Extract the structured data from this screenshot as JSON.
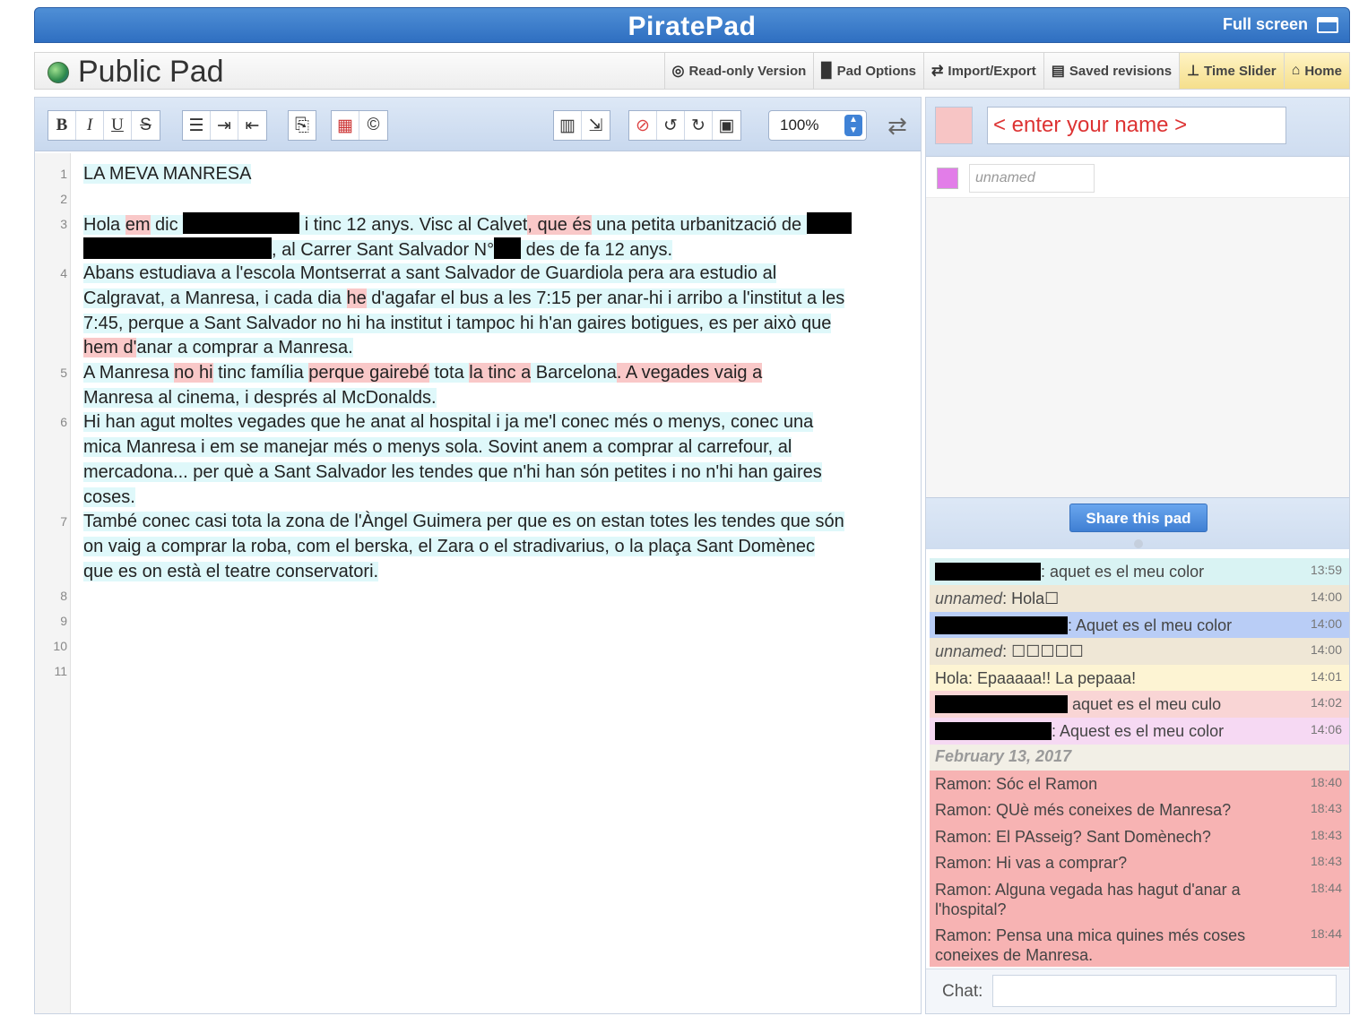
{
  "app": {
    "brand": "PiratePad",
    "fullscreen_label": "Full screen"
  },
  "pad": {
    "title": "Public Pad"
  },
  "nav": [
    {
      "label": "Read-only Version",
      "icon": "eye-icon"
    },
    {
      "label": "Pad Options",
      "icon": "document-icon"
    },
    {
      "label": "Import/Export",
      "icon": "arrows-icon"
    },
    {
      "label": "Saved revisions",
      "icon": "save-icon"
    },
    {
      "label": "Time Slider",
      "icon": "slider-icon"
    },
    {
      "label": "Home",
      "icon": "home-icon"
    }
  ],
  "toolbar": {
    "format": [
      "B",
      "I",
      "U",
      "S"
    ],
    "lists": [
      "☰",
      "⇥",
      "⇤"
    ],
    "zoom": "100%"
  },
  "editor": {
    "line_numbers": [
      "1",
      "2",
      "3",
      "4",
      "5",
      "6",
      "7",
      "8",
      "9",
      "10",
      "11"
    ],
    "line1": "LA MEVA MANRESA",
    "l3a": "Hola ",
    "l3b": "em",
    "l3c": " dic ",
    "l3d": " i tinc 12 anys. Visc al Calvet",
    "l3e": ", que és",
    "l3f": " una petita urbanització de ",
    "l3g": ", al Carrer Sant Salvador N°",
    "l3h": " des de fa 12 anys.",
    "l4a": "Abans estudiava a l'escola Montserrat a sant Salvador de Guardiola pera ara estudio al",
    "l4b": "Calgravat, a Manresa, i cada dia ",
    "l4c": "he",
    "l4d": " d'agafar el bus a les 7:15 per anar-hi i arribo a l'institut a les",
    "l4e": "7:45, perque a Sant Salvador no hi ha institut i tampoc hi h'an gaires botigues, es per això que",
    "l4f": "hem d'",
    "l4g": "anar a comprar a Manresa.",
    "l5a": "A Manresa ",
    "l5b": "no hi",
    "l5c": "  tinc família ",
    "l5d": "perque  gairebé",
    "l5e": " tota ",
    "l5f": "la tinc a",
    "l5g": " Barcelona",
    "l5h": ". A vegades vaig a",
    "l5i": "Manresa al cinema, i després al McDonalds.",
    "l6a": "Hi han agut moltes vegades que he anat al hospital i ja me'l conec més o menys, conec una",
    "l6b": "mica Manresa i em se manejar més o menys sola. Sovint anem a comprar al carrefour,  al",
    "l6c": "mercadona... per què a Sant Salvador les tendes que n'hi han són petites i no n'hi han gaires",
    "l6d": "coses.",
    "l7a": "També conec casi tota la zona de l'Àngel Guimera per que es on estan totes les tendes que són",
    "l7b": "on vaig a comprar la roba, com el berska, el Zara o el stradivarius, o la plaça Sant Domènec",
    "l7c": "que es on està el teatre conservatori."
  },
  "users": {
    "name_placeholder": "< enter your name >",
    "other_user": "unnamed",
    "my_color": "#f7c5c5",
    "other_color": "#e27de8"
  },
  "share_label": "Share this pad",
  "chat": {
    "messages": [
      {
        "text": ": aquet es el meu color",
        "time": "13:59",
        "color": "#d9f3f3"
      },
      {
        "author": "unnamed",
        "text": ": Hola☐",
        "time": "14:00",
        "color": "#efe7d6"
      },
      {
        "text": ": Aquet es el meu color",
        "time": "14:00",
        "color": "#b9cdf6"
      },
      {
        "author": "unnamed",
        "text": ": ☐☐☐☐☐",
        "time": "14:00",
        "color": "#efe7d6"
      },
      {
        "text": "Hola: Epaaaaa!! La pepaaa!",
        "time": "14:01",
        "color": "#fdf4d3"
      },
      {
        "text": " aquet es el meu culo",
        "time": "14:02",
        "color": "#f9d5d5"
      },
      {
        "text": ": Aquest es el meu color",
        "time": "14:06",
        "color": "#f6d9f3"
      }
    ],
    "date_header": "February 13, 2017",
    "ramon": [
      {
        "text": "Ramon: Sóc el Ramon",
        "time": "18:40"
      },
      {
        "text": "Ramon: QUè més coneixes de Manresa?",
        "time": "18:43"
      },
      {
        "text": "Ramon: El PAsseig? Sant Domènech?",
        "time": "18:43"
      },
      {
        "text": "Ramon: Hi vas a comprar?",
        "time": "18:43"
      },
      {
        "text": "Ramon: Alguna vegada has hagut d'anar a l'hospital?",
        "time": "18:44"
      },
      {
        "text": "Ramon: Pensa una mica quines més coses coneixes de Manresa.",
        "time": "18:44"
      }
    ],
    "ramon_color": "#f7b3b3",
    "input_label": "Chat:"
  }
}
